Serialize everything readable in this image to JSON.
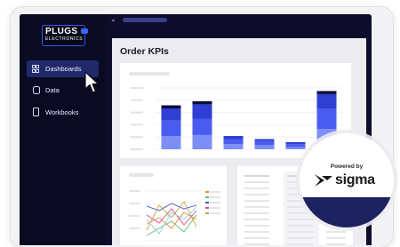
{
  "brand": {
    "logo_main": "PLUGS",
    "logo_sub": "ELECTRONICS"
  },
  "nav": {
    "items": [
      {
        "label": "Dashboards",
        "icon": "grid-icon",
        "active": true
      },
      {
        "label": "Data",
        "icon": "database-icon",
        "active": false
      },
      {
        "label": "Workbooks",
        "icon": "tablet-icon",
        "active": false
      }
    ]
  },
  "page": {
    "title": "Order KPIs"
  },
  "badge": {
    "powered_by": "Powered by",
    "wordmark": "sigma"
  },
  "colors": {
    "accent": "#2f58e8",
    "bar_dark": "#0c0c3a",
    "bar_mid": "#2e3fd1",
    "bar_bright": "#4a5cf0",
    "bar_light": "#7d8ff7"
  },
  "chart_data": {
    "type": "bar",
    "categories": [
      "",
      "",
      "",
      "",
      "",
      ""
    ],
    "series": [
      {
        "values": [
          3,
          3,
          0,
          0,
          0,
          3
        ]
      },
      {
        "values": [
          12,
          14,
          3,
          2,
          2,
          14
        ]
      },
      {
        "values": [
          15,
          16,
          5,
          4,
          3,
          20
        ]
      },
      {
        "values": [
          13,
          14,
          5,
          4,
          2,
          20
        ]
      }
    ],
    "colors": [
      "#0c0c3a",
      "#2e3fd1",
      "#4a5cf0",
      "#7d8ff7"
    ],
    "ylim": [
      0,
      60
    ],
    "grid": true
  }
}
